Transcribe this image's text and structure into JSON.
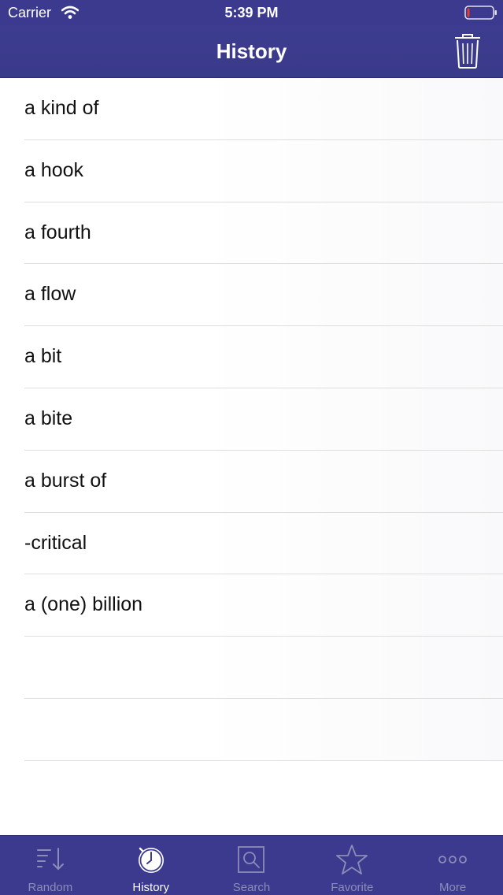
{
  "status_bar": {
    "carrier": "Carrier",
    "time": "5:39 PM"
  },
  "nav": {
    "title": "History"
  },
  "history": {
    "items": [
      {
        "label": "a kind of"
      },
      {
        "label": "a hook"
      },
      {
        "label": "a fourth"
      },
      {
        "label": "a flow"
      },
      {
        "label": "a bit"
      },
      {
        "label": "a bite"
      },
      {
        "label": "a burst of"
      },
      {
        "label": "-critical"
      },
      {
        "label": "a (one) billion"
      },
      {
        "label": ""
      },
      {
        "label": ""
      }
    ]
  },
  "tabs": [
    {
      "label": "Random",
      "icon": "sort-down-icon",
      "active": false
    },
    {
      "label": "History",
      "icon": "clock-icon",
      "active": true
    },
    {
      "label": "Search",
      "icon": "search-icon",
      "active": false
    },
    {
      "label": "Favorite",
      "icon": "star-icon",
      "active": false
    },
    {
      "label": "More",
      "icon": "more-icon",
      "active": false
    }
  ],
  "colors": {
    "bar_background": "#3b3a8e",
    "tab_inactive": "#8c8cb8",
    "tab_active": "#ffffff",
    "battery_low": "#e53935"
  }
}
